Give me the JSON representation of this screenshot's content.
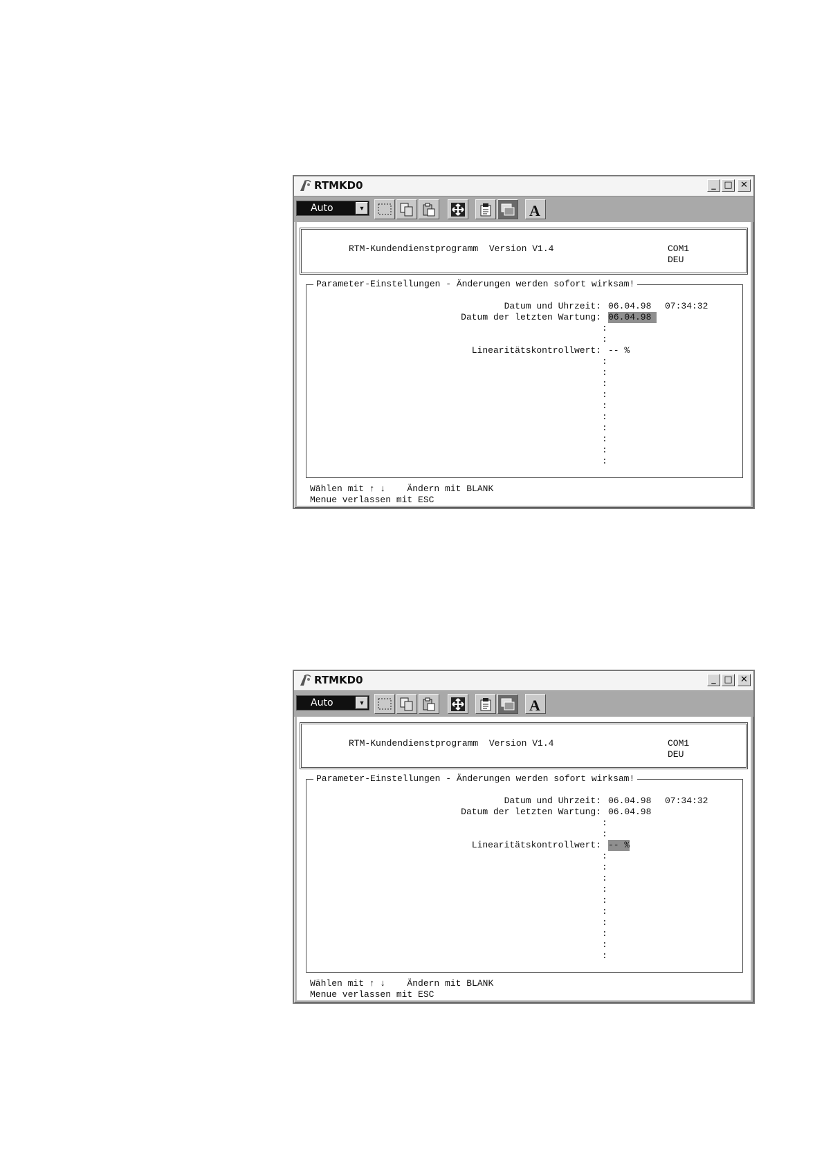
{
  "window_title": "RTMKD0",
  "toolbar": {
    "combo_value": "Auto",
    "buttons": [
      "mark-icon",
      "copy-icon",
      "paste-icon",
      "fullscreen-icon",
      "properties-icon",
      "background-icon",
      "font-icon"
    ]
  },
  "header": {
    "program": "RTM-Kundendienstprogramm  Version V1.4",
    "port": "COM1",
    "language": "DEU"
  },
  "params": {
    "title": "Parameter-Einstellungen - Änderungen werden sofort wirksam!",
    "datetime_label": "Datum und Uhrzeit:",
    "date_value": "06.04.98",
    "time_value": "07:34:32",
    "maintenance_label": "Datum der letzten Wartung:",
    "maintenance_value": "06.04.98",
    "linearity_label": "Linearitätskontrollwert:",
    "linearity_value": "-- %",
    "colon": ":"
  },
  "footer": {
    "line1": "Wählen mit ↑ ↓    Ändern mit BLANK",
    "line2": "Menue verlassen mit ESC"
  },
  "screens": [
    {
      "selected_field": "maintenance"
    },
    {
      "selected_field": "linearity"
    }
  ]
}
